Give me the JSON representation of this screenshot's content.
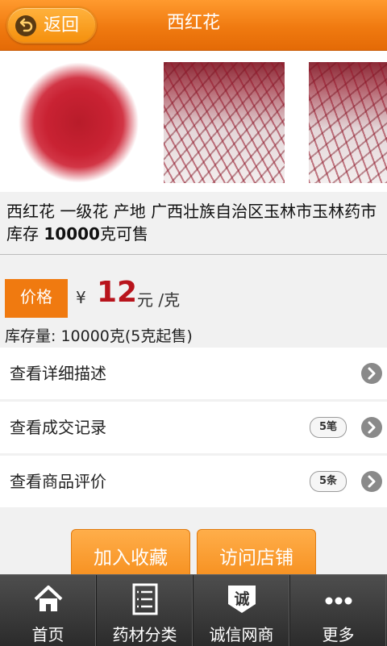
{
  "header": {
    "back_label": "返回",
    "title": "西红花"
  },
  "product": {
    "description_prefix": "西红花 一级花 产地 广西壮族自治区玉林市玉林药市 库存 ",
    "description_stock": "10000",
    "description_suffix": "克可售",
    "price_label": "价格",
    "currency_symbol": "¥",
    "price": "12",
    "price_unit": "元 /克",
    "stock_text": "库存量: 10000克(5克起售)"
  },
  "rows": [
    {
      "label": "查看详细描述",
      "badge": ""
    },
    {
      "label": "查看成交记录",
      "badge": "5笔"
    },
    {
      "label": "查看商品评价",
      "badge": "5条"
    }
  ],
  "actions": {
    "favorite_label": "加入收藏",
    "visit_store_label": "访问店铺"
  },
  "tabbar": [
    {
      "label": "首页",
      "icon": "home-icon"
    },
    {
      "label": "药材分类",
      "icon": "category-list-icon"
    },
    {
      "label": "诚信网商",
      "icon": "integrity-badge-icon"
    },
    {
      "label": "更多",
      "icon": "more-dots-icon"
    }
  ],
  "colors": {
    "accent": "#f07a10",
    "price": "#b8141c",
    "tabbar": "#3a3a3a"
  }
}
